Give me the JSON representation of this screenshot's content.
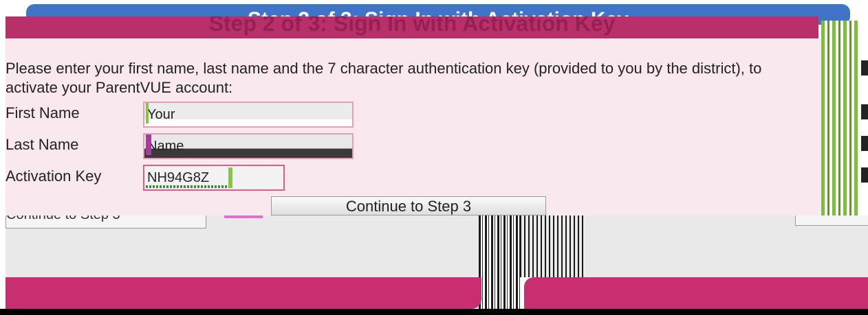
{
  "header": {
    "title": "Step 2 of 3: Sign In with Activation Key"
  },
  "instructions": "Please enter your first name, last name and the 7 character authentication key (provided to you by the district), to activate your ParentVUE account:",
  "form": {
    "first_name_label": "First Name",
    "first_name_value": "Your",
    "last_name_label": "Last Name",
    "last_name_value": "Name",
    "activation_key_label": "Activation Key",
    "activation_key_value": "NH94G8Z"
  },
  "buttons": {
    "continue_step3": "Continue to Step 3",
    "continue_ghost": "Continue to Step 3"
  },
  "colors": {
    "header_blue": "#3f74c6",
    "header_magenta": "#b82f6a",
    "panel_bg": "#f9e8ee",
    "footer": "#c92e70"
  }
}
